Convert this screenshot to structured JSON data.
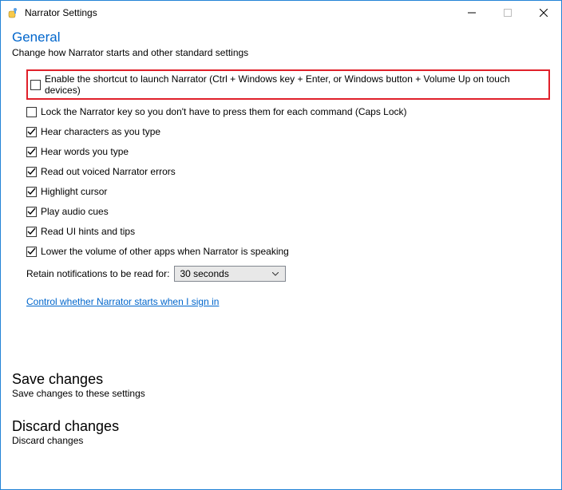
{
  "titlebar": {
    "title": "Narrator Settings"
  },
  "general": {
    "heading": "General",
    "subheading": "Change how Narrator starts and other standard settings"
  },
  "options": [
    {
      "label": "Enable the shortcut to launch Narrator (Ctrl + Windows key + Enter, or Windows button + Volume Up on touch devices)",
      "checked": false,
      "highlight": true
    },
    {
      "label": "Lock the Narrator key so you don't have to press them for each command (Caps Lock)",
      "checked": false
    },
    {
      "label": "Hear characters as you type",
      "checked": true
    },
    {
      "label": "Hear words you type",
      "checked": true
    },
    {
      "label": "Read out voiced Narrator errors",
      "checked": true
    },
    {
      "label": "Highlight cursor",
      "checked": true
    },
    {
      "label": "Play audio cues",
      "checked": true
    },
    {
      "label": "Read UI hints and tips",
      "checked": true
    },
    {
      "label": "Lower the volume of other apps when Narrator is speaking",
      "checked": true
    }
  ],
  "retain": {
    "label": "Retain notifications to be read for:",
    "value": "30 seconds"
  },
  "signin_link": "Control whether Narrator starts when I sign in",
  "save": {
    "heading": "Save changes",
    "sub": "Save changes to these settings"
  },
  "discard": {
    "heading": "Discard changes",
    "sub": "Discard changes"
  }
}
